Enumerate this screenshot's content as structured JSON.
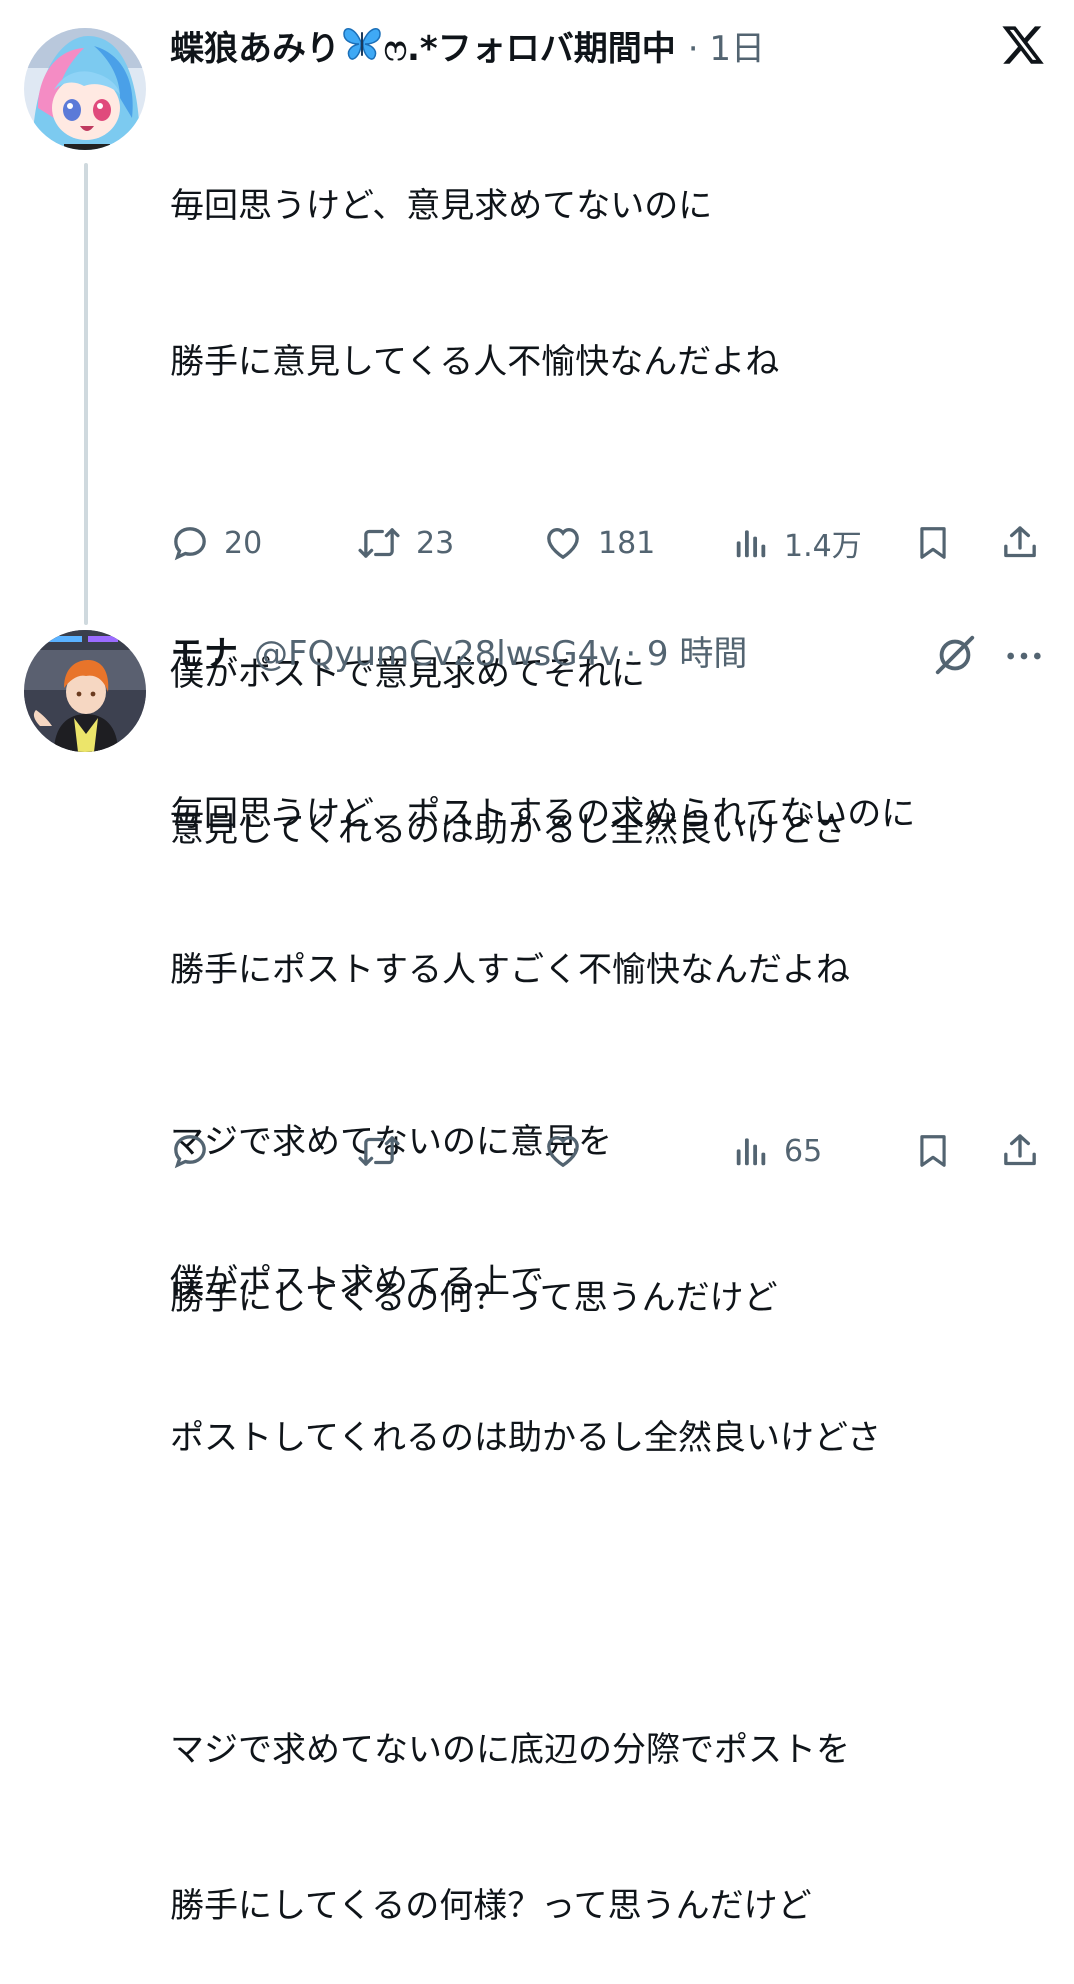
{
  "tweet1": {
    "display_name": "蝶狼あみり",
    "name_suffix": "ෆ.*フォロバ期間中",
    "meta": "· 1日",
    "text_lines": [
      "毎回思うけど、意見求めてないのに",
      "勝手に意見してくる人不愉快なんだよね",
      "",
      "僕がポストで意見求めてそれに",
      "意見してくれるのは助かるし全然良いけどさ",
      "",
      "マジで求めてないのに意見を",
      "勝手にしてくるの何？って思うんだけど"
    ],
    "replies": "20",
    "reposts": "23",
    "likes": "181",
    "views": "1.4万"
  },
  "tweet2": {
    "display_name": "モナ",
    "handle": "@FQyumCv28lwsG4v",
    "meta": "· 9 時間",
    "text_lines": [
      "毎回思うけど、ポストするの求められてないのに",
      "勝手にポストする人すごく不愉快なんだよね",
      "",
      "僕がポスト求めてる上で",
      "ポストしてくれるのは助かるし全然良いけどさ",
      "",
      "マジで求めてないのに底辺の分際でポストを",
      "勝手にしてくるの何様？って思うんだけど"
    ],
    "views": "65"
  },
  "icons": {
    "close": "x-logo-icon",
    "reply": "reply-icon",
    "repost": "repost-icon",
    "like": "heart-icon",
    "views": "views-icon",
    "bookmark": "bookmark-icon",
    "share": "share-icon",
    "grok": "grok-icon",
    "more": "more-icon"
  },
  "colors": {
    "text": "#0f1419",
    "secondary": "#536471",
    "thread_line": "#cfd9de",
    "butterfly": "#3fa9f5"
  }
}
